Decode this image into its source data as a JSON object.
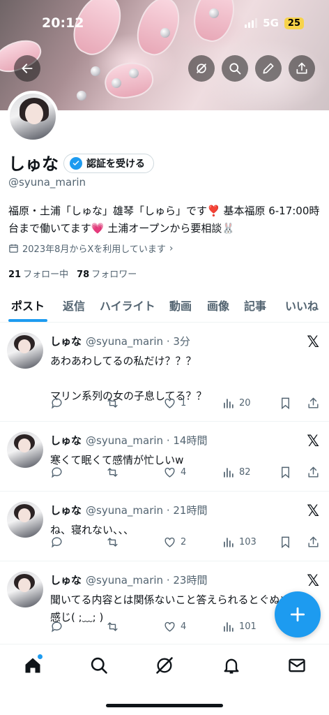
{
  "status_bar": {
    "time": "20:12",
    "network": "5G",
    "battery": "25"
  },
  "profile": {
    "name": "しゅな",
    "verify_button": "認証を受ける",
    "handle": "@syuna_marin",
    "bio": "福原・土浦「しゅな」雄琴「しゅら」です❣️ 基本福原 6-17:00時台まで働いてます💗 土浦オープンから要相談🐰",
    "joined": "2023年8月からXを利用しています",
    "following_count": "21",
    "following_label": "フォロー中",
    "followers_count": "78",
    "followers_label": "フォロワー"
  },
  "tabs": [
    "ポスト",
    "返信",
    "ハイライト",
    "動画",
    "画像",
    "記事",
    "いいね"
  ],
  "active_tab": "ポスト",
  "posts": [
    {
      "name": "しゅな",
      "meta": "@syuna_marin · 3分",
      "text": "あわあわしてるの私だけ？？？\n\nマリン系列の女の子息してる？？",
      "likes": "1",
      "views": "20"
    },
    {
      "name": "しゅな",
      "meta": "@syuna_marin · 14時間",
      "text": "寒くて眠くて感情が忙しいw",
      "likes": "4",
      "views": "82"
    },
    {
      "name": "しゅな",
      "meta": "@syuna_marin · 21時間",
      "text": "ね、寝れない、、、",
      "likes": "2",
      "views": "103"
    },
    {
      "name": "しゅな",
      "meta": "@syuna_marin · 23時間",
      "text": "聞いてる内容とは関係ないこと答えられるとぐぬぬって感じ( ;﹏; )",
      "likes": "4",
      "views": "101"
    }
  ],
  "colors": {
    "accent": "#1d9bf0",
    "text": "#0f1419",
    "muted": "#536471"
  },
  "icons": [
    "back-arrow-icon",
    "grok-icon",
    "search-icon",
    "edit-pencil-icon",
    "share-icon",
    "calendar-icon",
    "x-logo-icon",
    "reply-icon",
    "repost-icon",
    "like-icon",
    "views-icon",
    "bookmark-icon",
    "plus-icon",
    "home-icon",
    "bell-icon",
    "mail-icon"
  ]
}
